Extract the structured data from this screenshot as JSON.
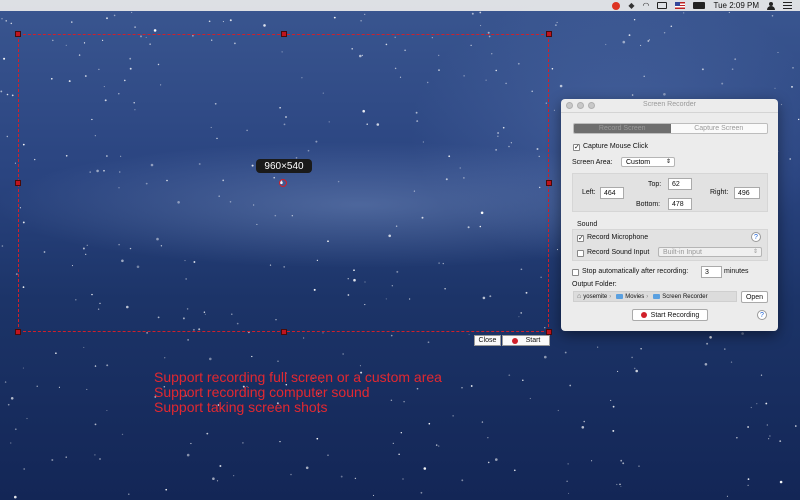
{
  "menubar": {
    "clock": "Tue 2:09 PM",
    "icons": [
      "recorder-icon",
      "dropbox-icon",
      "wifi-icon",
      "display-icon",
      "flag-icon",
      "battery-icon"
    ]
  },
  "selection": {
    "size_label": "960×540",
    "close_label": "Close",
    "start_label": "Start"
  },
  "captions": [
    "Support recording full screen or a custom area",
    "Support recording computer sound",
    "Support taking screen shots"
  ],
  "window": {
    "title": "Screen Recorder",
    "tabs": [
      "Record Screen",
      "Capture Screen"
    ],
    "capture_mouse_click": "Capture Mouse Click",
    "screen_area_label": "Screen Area:",
    "screen_area_value": "Custom",
    "left_label": "Left:",
    "left_value": "464",
    "top_label": "Top:",
    "top_value": "62",
    "right_label": "Right:",
    "right_value": "496",
    "bottom_label": "Bottom:",
    "bottom_value": "478",
    "sound_label": "Sound",
    "record_microphone": "Record Microphone",
    "record_sound_input": "Record Sound Input",
    "sound_input_value": "Built-in Input",
    "stop_label": "Stop automatically after recording:",
    "stop_value": "3",
    "minutes_label": "minutes",
    "output_folder_label": "Output Folder:",
    "path": [
      "yosemite",
      "Movies",
      "Screen Recorder"
    ],
    "open_label": "Open",
    "start_recording_label": "Start Recording",
    "help_symbol": "?"
  },
  "colors": {
    "accent_red": "#d0202a",
    "caption_red": "#e22830"
  }
}
